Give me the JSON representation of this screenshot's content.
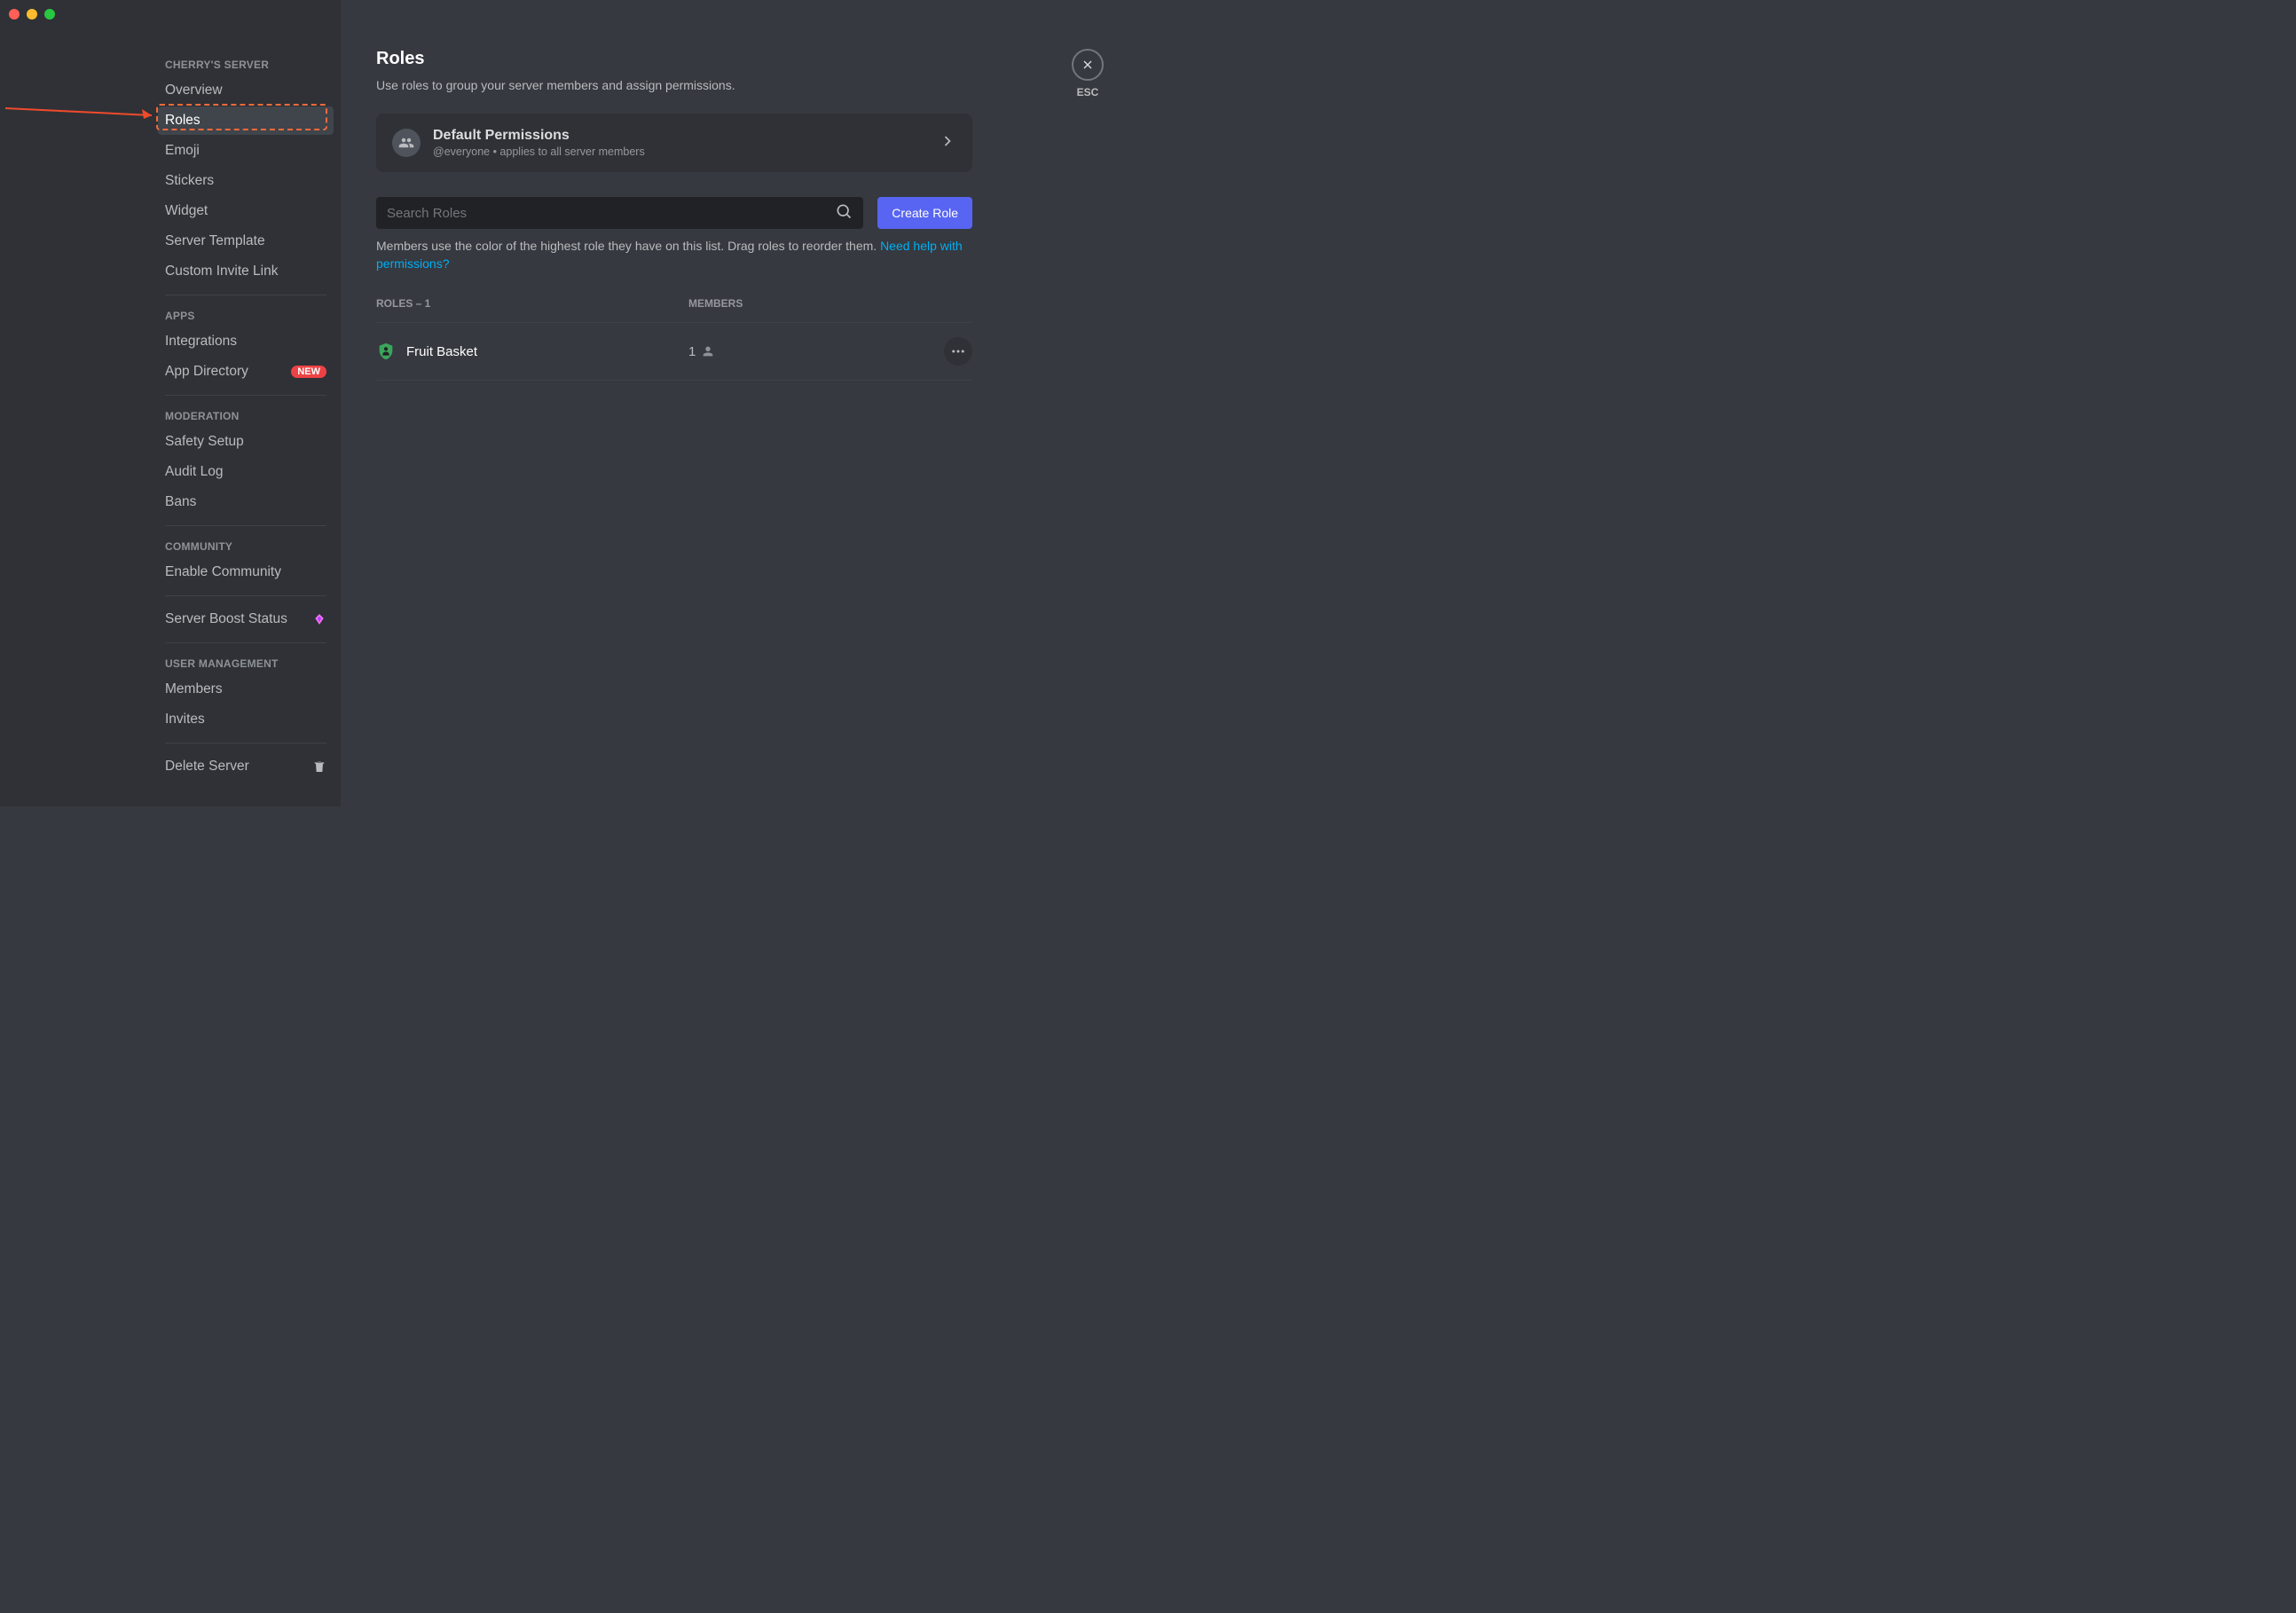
{
  "sidebar": {
    "server_name_header": "CHERRY'S SERVER",
    "items_main": [
      {
        "label": "Overview"
      },
      {
        "label": "Roles"
      },
      {
        "label": "Emoji"
      },
      {
        "label": "Stickers"
      },
      {
        "label": "Widget"
      },
      {
        "label": "Server Template"
      },
      {
        "label": "Custom Invite Link"
      }
    ],
    "apps_header": "APPS",
    "items_apps": [
      {
        "label": "Integrations"
      },
      {
        "label": "App Directory",
        "badge": "NEW"
      }
    ],
    "moderation_header": "MODERATION",
    "items_moderation": [
      {
        "label": "Safety Setup"
      },
      {
        "label": "Audit Log"
      },
      {
        "label": "Bans"
      }
    ],
    "community_header": "COMMUNITY",
    "items_community": [
      {
        "label": "Enable Community"
      }
    ],
    "boost_label": "Server Boost Status",
    "user_mgmt_header": "USER MANAGEMENT",
    "items_user_mgmt": [
      {
        "label": "Members"
      },
      {
        "label": "Invites"
      }
    ],
    "delete_label": "Delete Server"
  },
  "main": {
    "title": "Roles",
    "subtitle": "Use roles to group your server members and assign permissions.",
    "default_permissions": {
      "title": "Default Permissions",
      "subtitle": "@everyone • applies to all server members"
    },
    "search_placeholder": "Search Roles",
    "create_button": "Create Role",
    "hint_text": "Members use the color of the highest role they have on this list. Drag roles to reorder them. ",
    "hint_link": "Need help with permissions?",
    "table": {
      "roles_header": "ROLES – 1",
      "members_header": "MEMBERS"
    },
    "roles": [
      {
        "name": "Fruit Basket",
        "members": "1",
        "color": "#3ba55c"
      }
    ]
  },
  "close": {
    "label": "ESC"
  }
}
